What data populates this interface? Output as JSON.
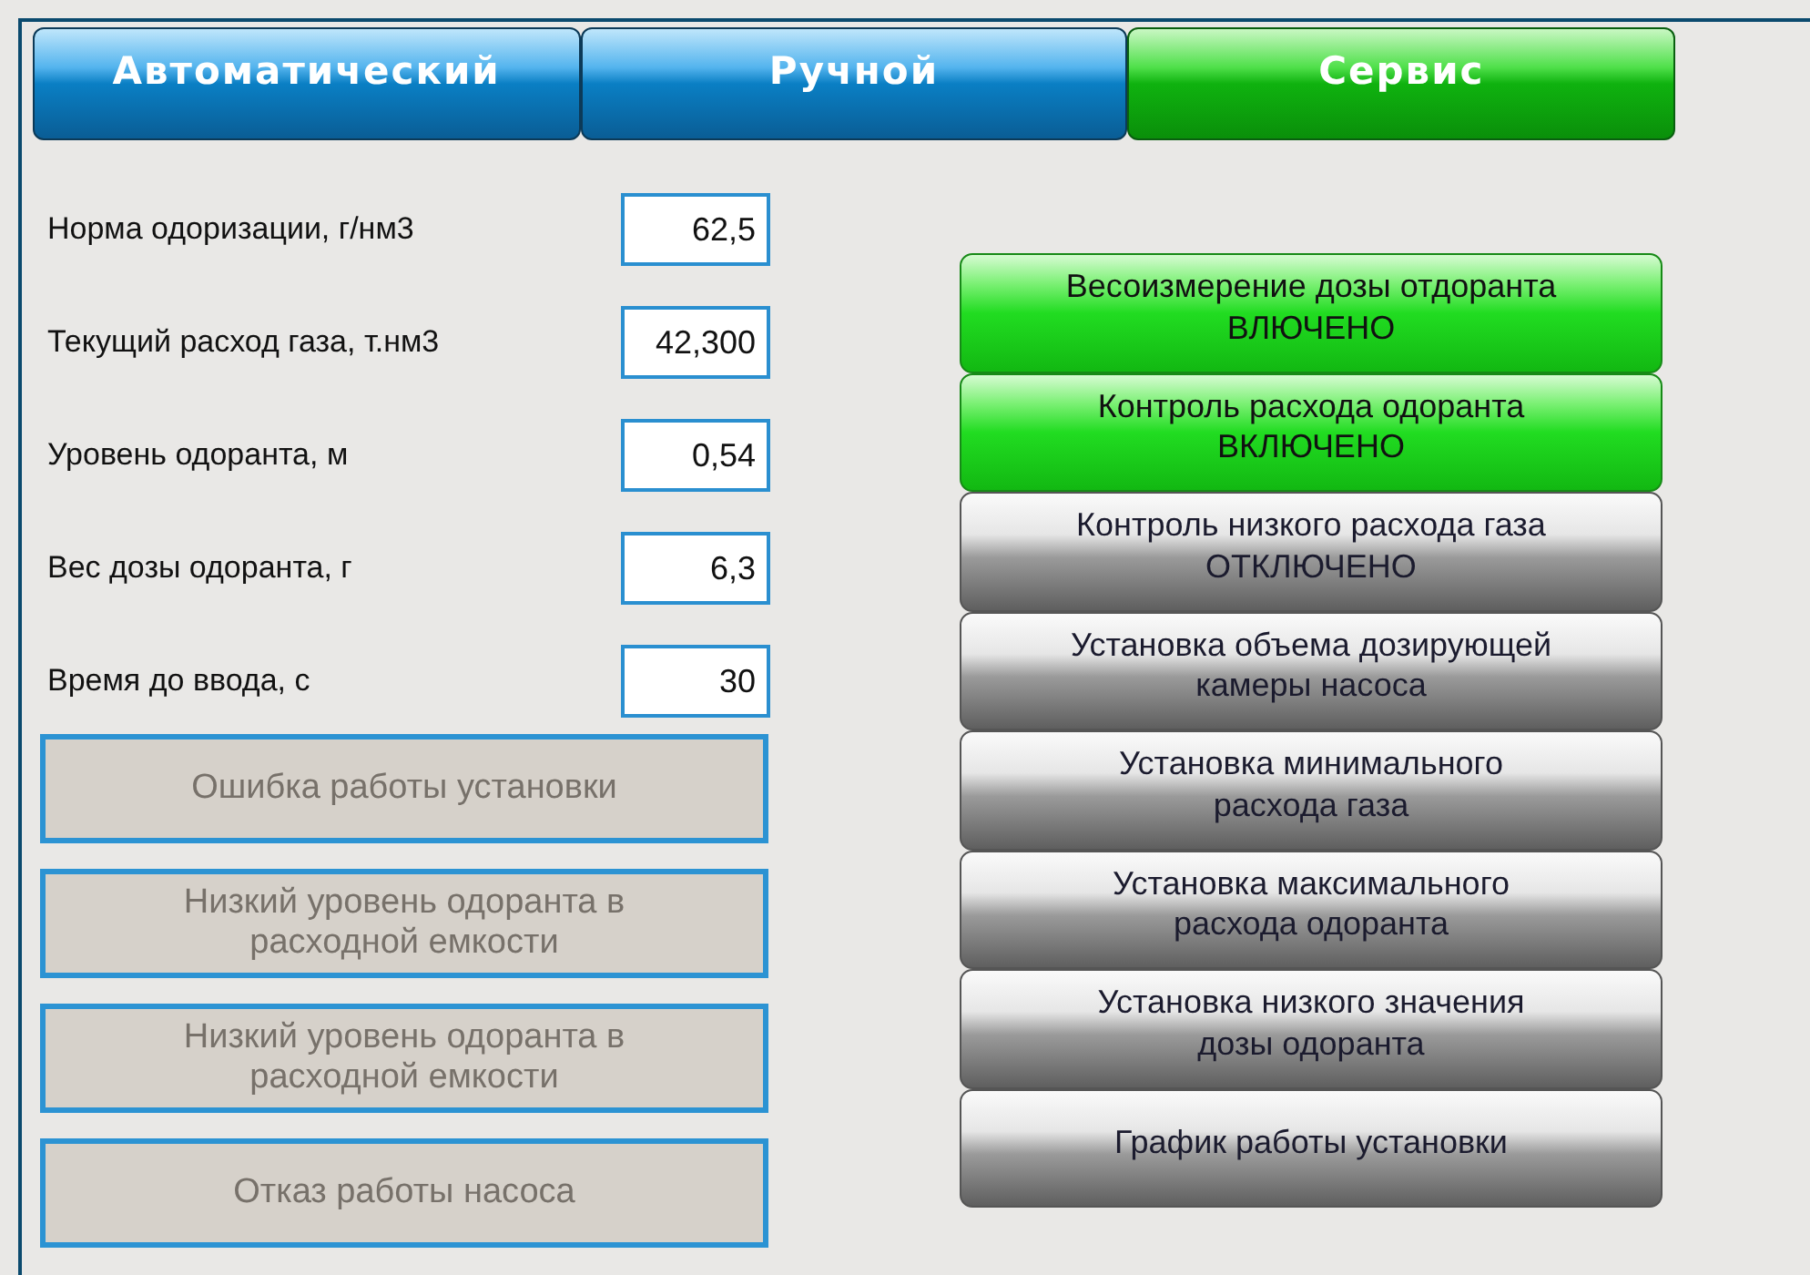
{
  "tabs": [
    {
      "label": "Автоматический",
      "selected": false
    },
    {
      "label": "Ручной",
      "selected": false
    },
    {
      "label": "Сервис",
      "selected": true
    }
  ],
  "parameters": [
    {
      "label": "Норма одоризации, г/нм3",
      "value": "62,5"
    },
    {
      "label": "Текущий расход газа, т.нм3",
      "value": "42,300"
    },
    {
      "label": "Уровень одоранта, м",
      "value": "0,54"
    },
    {
      "label": "Вес дозы одоранта, г",
      "value": "6,3"
    },
    {
      "label": "Время до ввода, с",
      "value": "30"
    }
  ],
  "alarms": [
    {
      "text": "Ошибка работы установки",
      "active": false
    },
    {
      "text": "Низкий уровень одоранта в расходной емкости",
      "active": false
    },
    {
      "text": "Низкий уровень одоранта в расходной емкости",
      "active": false
    },
    {
      "text": "Отказ работы насоса",
      "active": false
    }
  ],
  "service_buttons": [
    {
      "lines": [
        "Весоизмерение дозы отдоранта",
        "ВЛЮЧЕНО"
      ],
      "on": true
    },
    {
      "lines": [
        "Контроль расхода одоранта",
        "ВКЛЮЧЕНО"
      ],
      "on": true
    },
    {
      "lines": [
        "Контроль низкого расхода газа",
        "ОТКЛЮЧЕНО"
      ],
      "on": false
    },
    {
      "lines": [
        "Установка объема дозирующей",
        "камеры насоса"
      ],
      "on": false
    },
    {
      "lines": [
        "Установка минимального",
        "расхода газа"
      ],
      "on": false
    },
    {
      "lines": [
        "Установка максимального",
        "расхода одоранта"
      ],
      "on": false
    },
    {
      "lines": [
        "Установка низкого значения",
        "дозы одоранта"
      ],
      "on": false
    },
    {
      "lines": [
        "График работы установки"
      ],
      "on": false
    }
  ]
}
